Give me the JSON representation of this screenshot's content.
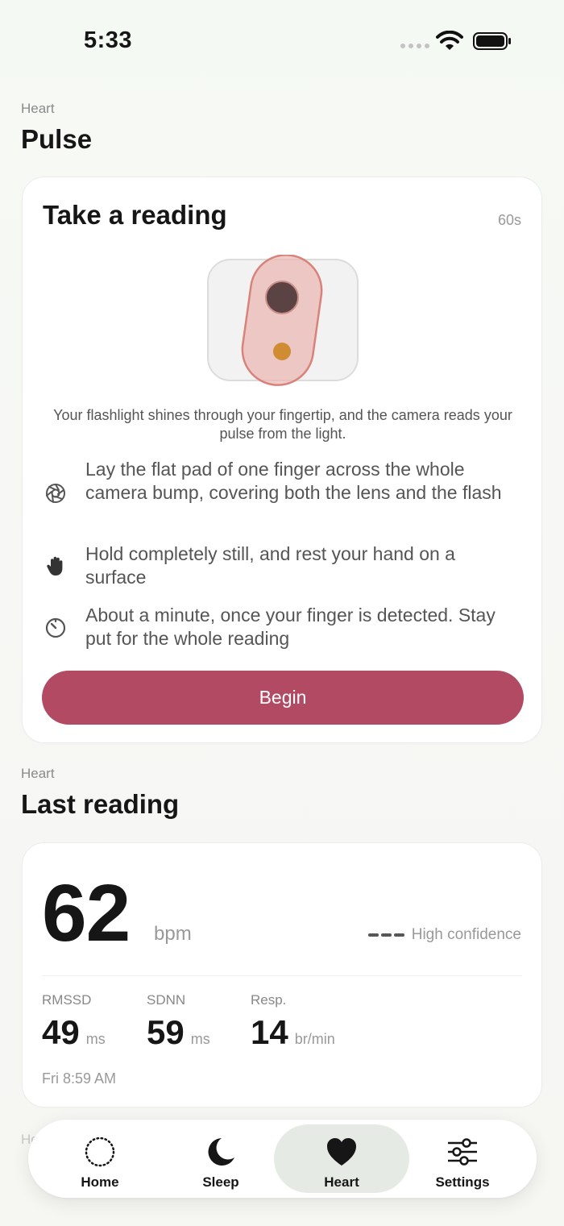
{
  "status_bar": {
    "time": "5:33"
  },
  "pulse_section": {
    "eyebrow": "Heart",
    "title": "Pulse",
    "card": {
      "title": "Take a reading",
      "duration": "60s",
      "explanation": "Your flashlight shines through your fingertip, and the camera reads your pulse from the light.",
      "steps": [
        {
          "icon": "camera-aperture-icon",
          "text": "Lay the flat pad of one finger across the whole camera bump, covering both the lens and the flash"
        },
        {
          "icon": "hand-icon",
          "text": "Hold completely still, and rest your hand on a surface"
        },
        {
          "icon": "timer-icon",
          "text": "About a minute, once your finger is detected. Stay put for the whole reading"
        }
      ],
      "button_label": "Begin"
    }
  },
  "last_reading_section": {
    "eyebrow": "Heart",
    "title": "Last reading",
    "bpm": "62",
    "bpm_unit": "bpm",
    "confidence": "High confidence",
    "metrics": [
      {
        "label": "RMSSD",
        "value": "49",
        "unit": "ms"
      },
      {
        "label": "SDNN",
        "value": "59",
        "unit": "ms"
      },
      {
        "label": "Resp.",
        "value": "14",
        "unit": "br/min"
      }
    ],
    "timestamp": "Fri 8:59 AM"
  },
  "next_section_peek": {
    "eyebrow": "He"
  },
  "tab_bar": {
    "tabs": [
      {
        "label": "Home",
        "icon": "dotted-circle-icon",
        "active": false
      },
      {
        "label": "Sleep",
        "icon": "moon-icon",
        "active": false
      },
      {
        "label": "Heart",
        "icon": "heart-icon",
        "active": true
      },
      {
        "label": "Settings",
        "icon": "sliders-icon",
        "active": false
      }
    ]
  },
  "colors": {
    "accent": "#b24a64",
    "background": "#f6f8f4",
    "card": "#ffffff",
    "active_tab": "#e6eae4",
    "finger": "#e9b5b0",
    "lens": "#5b4343",
    "flash": "#d08c33"
  }
}
